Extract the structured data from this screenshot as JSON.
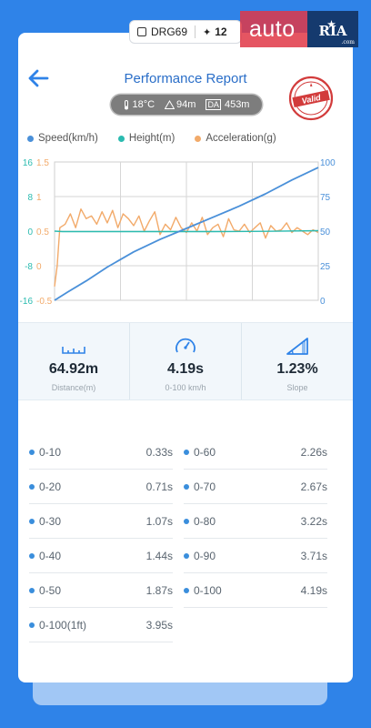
{
  "device": {
    "name": "DRG69",
    "satellites": "12"
  },
  "brand": {
    "auto": "auto",
    "ria": "RIA",
    "domain": ".com"
  },
  "header": {
    "title": "Performance Report",
    "stamp_text": "Valid"
  },
  "conditions": {
    "temperature": "18°C",
    "altitude": "94m",
    "da_label": "DA",
    "density_altitude": "453m"
  },
  "legend": [
    {
      "label": "Speed(km/h)",
      "color": "#4a90d9"
    },
    {
      "label": "Height(m)",
      "color": "#2bbbb0"
    },
    {
      "label": "Acceleration(g)",
      "color": "#f2aa6a"
    }
  ],
  "chart_data": {
    "type": "line",
    "axes": {
      "height_left": {
        "ticks": [
          "16",
          "8",
          "0",
          "-8",
          "-16"
        ],
        "range": [
          -16,
          16
        ],
        "color": "#2bbbb0"
      },
      "accel_left": {
        "ticks": [
          "1.5",
          "1",
          "0.5",
          "0",
          "-0.5"
        ],
        "range": [
          -0.5,
          1.5
        ],
        "color": "#f2aa6a"
      },
      "speed_right": {
        "ticks": [
          "100",
          "75",
          "50",
          "25",
          "0"
        ],
        "range": [
          0,
          100
        ],
        "color": "#4a90d9"
      }
    },
    "grid": true,
    "series": [
      {
        "name": "Speed(km/h)",
        "axis": "speed_right",
        "color": "#4a90d9",
        "x": [
          0,
          0.05,
          0.12,
          0.2,
          0.3,
          0.4,
          0.5,
          0.6,
          0.7,
          0.8,
          0.9,
          1.0
        ],
        "y": [
          0,
          6,
          14,
          24,
          35,
          44,
          52,
          60,
          68,
          77,
          87,
          96
        ]
      },
      {
        "name": "Height(m)",
        "axis": "height_left",
        "color": "#2bbbb0",
        "x": [
          0,
          0.03,
          0.2,
          0.4,
          0.6,
          0.8,
          1.0
        ],
        "y": [
          0,
          -0.1,
          -0.1,
          -0.1,
          -0.1,
          -0.05,
          0.1
        ]
      },
      {
        "name": "Acceleration(g)",
        "axis": "accel_left",
        "color": "#f2aa6a",
        "x": [
          0,
          0.01,
          0.02,
          0.04,
          0.06,
          0.08,
          0.1,
          0.12,
          0.14,
          0.16,
          0.18,
          0.2,
          0.22,
          0.24,
          0.26,
          0.28,
          0.3,
          0.32,
          0.34,
          0.36,
          0.38,
          0.4,
          0.42,
          0.44,
          0.46,
          0.48,
          0.5,
          0.52,
          0.54,
          0.56,
          0.58,
          0.6,
          0.62,
          0.64,
          0.66,
          0.68,
          0.7,
          0.72,
          0.74,
          0.76,
          0.78,
          0.8,
          0.82,
          0.84,
          0.86,
          0.88,
          0.9,
          0.92,
          0.94,
          0.96,
          0.98,
          1.0
        ],
        "y": [
          -0.3,
          0.0,
          0.55,
          0.6,
          0.75,
          0.55,
          0.82,
          0.68,
          0.72,
          0.6,
          0.78,
          0.62,
          0.8,
          0.55,
          0.75,
          0.68,
          0.58,
          0.72,
          0.5,
          0.65,
          0.78,
          0.45,
          0.6,
          0.52,
          0.7,
          0.55,
          0.48,
          0.62,
          0.5,
          0.7,
          0.45,
          0.55,
          0.6,
          0.42,
          0.68,
          0.52,
          0.5,
          0.6,
          0.48,
          0.55,
          0.62,
          0.4,
          0.58,
          0.5,
          0.52,
          0.62,
          0.48,
          0.55,
          0.5,
          0.45,
          0.52,
          0.48
        ]
      }
    ]
  },
  "stats": [
    {
      "value": "64.92m",
      "label": "Distance(m)",
      "icon": "ruler-icon"
    },
    {
      "value": "4.19s",
      "label": "0-100 km/h",
      "icon": "speedometer-icon"
    },
    {
      "value": "1.23%",
      "label": "Slope",
      "icon": "slope-icon"
    }
  ],
  "times": [
    {
      "name": "0-10",
      "time": "0.33s"
    },
    {
      "name": "0-60",
      "time": "2.26s"
    },
    {
      "name": "0-20",
      "time": "0.71s"
    },
    {
      "name": "0-70",
      "time": "2.67s"
    },
    {
      "name": "0-30",
      "time": "1.07s"
    },
    {
      "name": "0-80",
      "time": "3.22s"
    },
    {
      "name": "0-40",
      "time": "1.44s"
    },
    {
      "name": "0-90",
      "time": "3.71s"
    },
    {
      "name": "0-50",
      "time": "1.87s"
    },
    {
      "name": "0-100",
      "time": "4.19s"
    },
    {
      "name": "0-100(1ft)",
      "time": "3.95s"
    }
  ]
}
